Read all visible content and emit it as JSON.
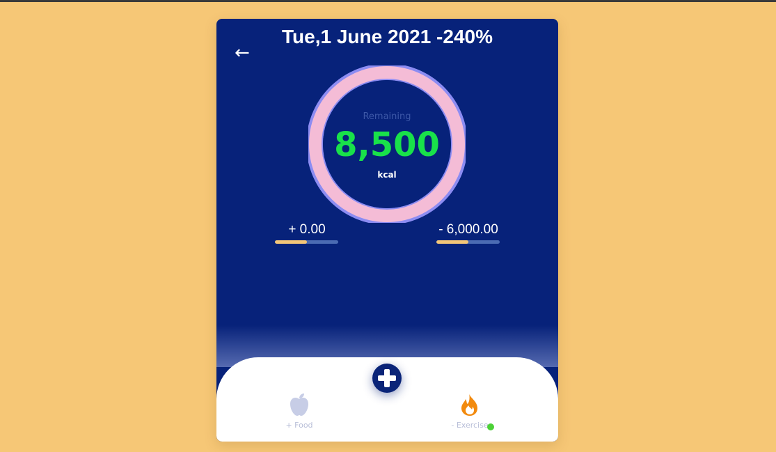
{
  "header": {
    "title": "Tue,1 June 2021 -240%",
    "back_glyph": "←"
  },
  "summary": {
    "remaining_label": "Remaining",
    "calories": "8,500",
    "unit": "kcal",
    "ring_fraction": 1.0
  },
  "stats": {
    "food": {
      "value": "+ 0.00",
      "progress": 0.5
    },
    "exercise": {
      "value": "- 6,000.00",
      "progress": 0.5
    }
  },
  "nav": {
    "food_label": "+ Food",
    "exercise_label": "- Exercise",
    "food_icon": "apple-icon",
    "exercise_icon": "flame-icon",
    "add_icon": "plus-icon"
  },
  "colors": {
    "background": "#f6c776",
    "card": "#07227a",
    "calories": "#19e14a",
    "ring": "#f4bcd6",
    "ring_border": "#8c8cf2",
    "bar_fill": "#f3c678",
    "bar_track": "#4b6bb3",
    "exercise_icon": "#f28a0e",
    "status_dot": "#4cd137"
  }
}
